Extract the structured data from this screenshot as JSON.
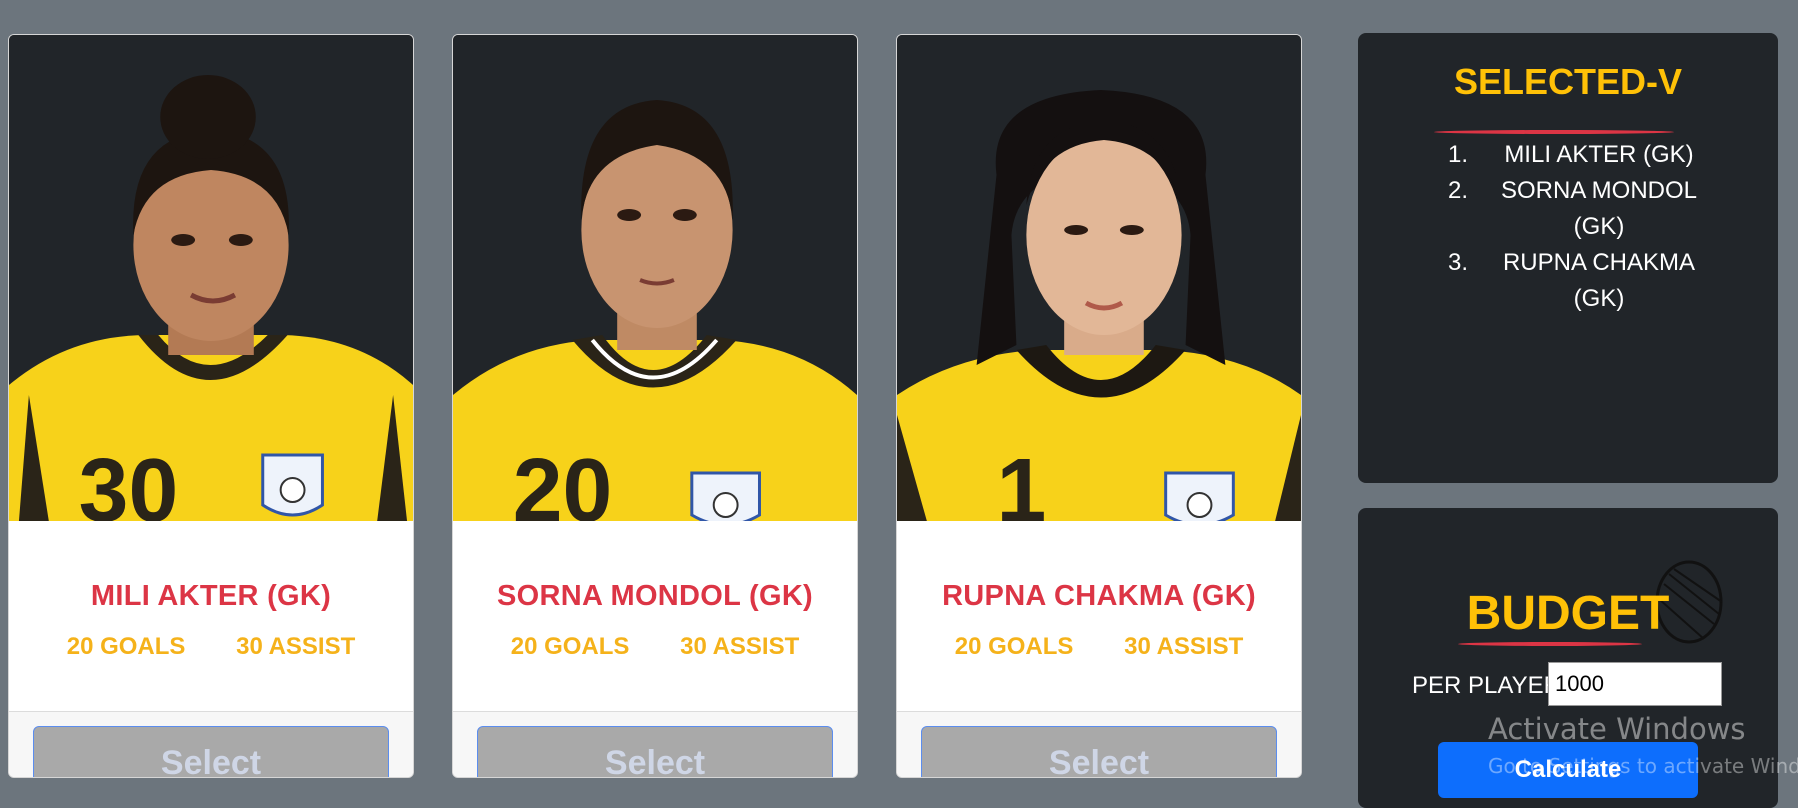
{
  "players": [
    {
      "name": "MILI AKTER (GK)",
      "goals": "20 GOALS",
      "assist": "30 ASSIST",
      "select_label": "Select",
      "jersey_number": "30"
    },
    {
      "name": "SORNA MONDOL (GK)",
      "goals": "20 GOALS",
      "assist": "30 ASSIST",
      "select_label": "Select",
      "jersey_number": "20"
    },
    {
      "name": "RUPNA CHAKMA (GK)",
      "goals": "20 GOALS",
      "assist": "30 ASSIST",
      "select_label": "Select",
      "jersey_number": "1"
    }
  ],
  "selected": {
    "title": "SELECTED-V",
    "items": [
      {
        "num": "1.",
        "label": "MILI AKTER (GK)"
      },
      {
        "num": "2.",
        "label": "SORNA MONDOL (GK)"
      },
      {
        "num": "3.",
        "label": "RUPNA CHAKMA (GK)"
      }
    ]
  },
  "budget": {
    "title": "BUDGET",
    "per_player_label": "PER PLAYER:",
    "per_player_value": "1000",
    "calculate_label": "Calculate"
  },
  "watermark": {
    "line1": "Activate Windows",
    "line2": "Go to Settings to activate Windows."
  },
  "colors": {
    "page_bg": "#6c757d",
    "panel_bg": "#212529",
    "accent_yellow": "#ffc107",
    "name_red": "#dc3545",
    "primary_blue": "#0d6efd"
  }
}
